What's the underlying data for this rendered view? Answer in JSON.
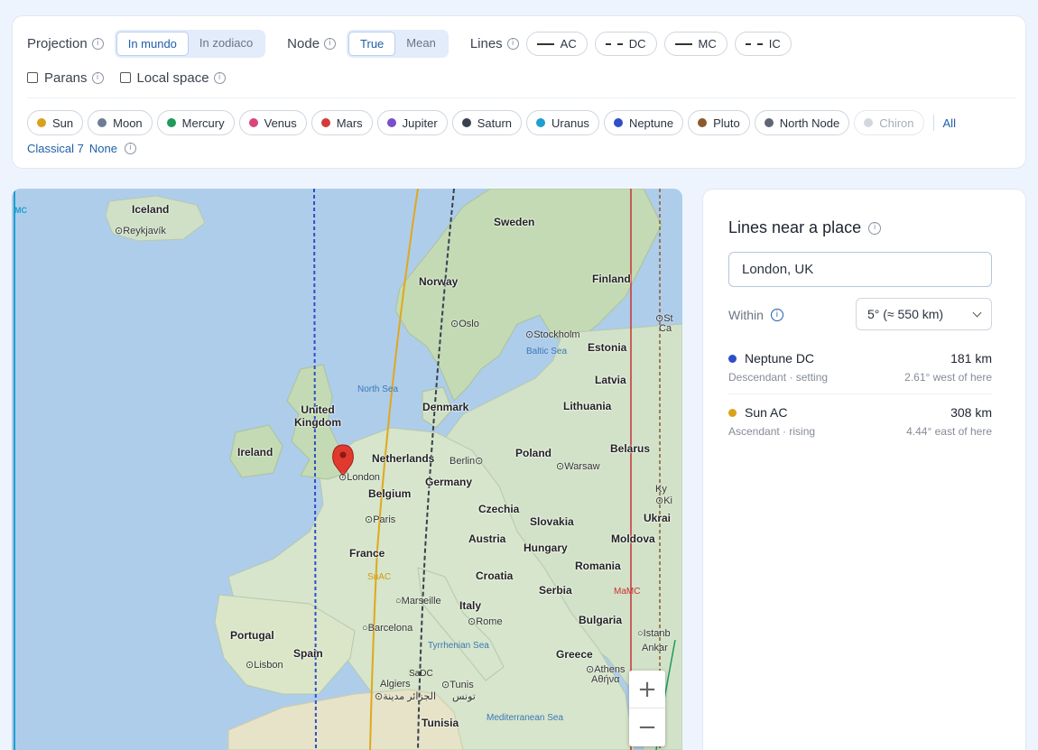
{
  "controls": {
    "projection": {
      "label": "Projection",
      "options": [
        "In mundo",
        "In zodiaco"
      ],
      "selected": "In mundo"
    },
    "node": {
      "label": "Node",
      "options": [
        "True",
        "Mean"
      ],
      "selected": "True"
    },
    "lines": {
      "label": "Lines",
      "items": [
        {
          "label": "AC",
          "style": "solid"
        },
        {
          "label": "DC",
          "style": "dashed"
        },
        {
          "label": "MC",
          "style": "solid"
        },
        {
          "label": "IC",
          "style": "dashed"
        }
      ]
    },
    "parans_label": "Parans",
    "local_space_label": "Local space",
    "planets": [
      {
        "label": "Sun",
        "color": "#d9a21b",
        "enabled": true
      },
      {
        "label": "Moon",
        "color": "#6e7c95",
        "enabled": true
      },
      {
        "label": "Mercury",
        "color": "#1f9b5a",
        "enabled": true
      },
      {
        "label": "Venus",
        "color": "#d8457a",
        "enabled": true
      },
      {
        "label": "Mars",
        "color": "#d33b3b",
        "enabled": true
      },
      {
        "label": "Jupiter",
        "color": "#7b4fc9",
        "enabled": true
      },
      {
        "label": "Saturn",
        "color": "#39414e",
        "enabled": true
      },
      {
        "label": "Uranus",
        "color": "#1f9ed1",
        "enabled": true
      },
      {
        "label": "Neptune",
        "color": "#2e4fc7",
        "enabled": true
      },
      {
        "label": "Pluto",
        "color": "#8a5a2b",
        "enabled": true
      },
      {
        "label": "North Node",
        "color": "#5f6775",
        "enabled": true
      },
      {
        "label": "Chiron",
        "color": "#d4d8de",
        "enabled": false
      }
    ],
    "all_label": "All",
    "classical_label": "Classical 7",
    "none_label": "None"
  },
  "map": {
    "countries": [
      "Iceland",
      "Sweden",
      "Norway",
      "Finland",
      "Estonia",
      "Latvia",
      "Lithuania",
      "Denmark",
      "United Kingdom",
      "Ireland",
      "Netherlands",
      "Belarus",
      "Poland",
      "Germany",
      "Belgium",
      "Czechia",
      "Slovakia",
      "Ukrai",
      "France",
      "Austria",
      "Hungary",
      "Moldova",
      "Romania",
      "Croatia",
      "Serbia",
      "Italy",
      "Bulgaria",
      "Portugal",
      "Spain",
      "Greece",
      "Tunisia"
    ],
    "cities": [
      "Reykjavík",
      "Oslo",
      "Stockholm",
      "London",
      "Berlin",
      "Warsaw",
      "Paris",
      "Marseille",
      "Rome",
      "Barcelona",
      "Lisbon",
      "Algiers",
      "الجزائر",
      "مدينة",
      "Tunis",
      "تونس",
      "Athens",
      "Αθήνα",
      "Istanb",
      "Ankar",
      "Ky",
      "Ki",
      "St",
      "Ca"
    ],
    "seas": [
      "North Sea",
      "Baltic Sea",
      "Tyrrhenian Sea",
      "Mediterranean Sea"
    ],
    "line_labels": {
      "mc_left": "MC",
      "sun_ac": "SuAC",
      "sa_dc": "SaDC",
      "ma_mc": "MaMC"
    },
    "colors": {
      "sun": "#e0a81c",
      "neptune": "#2e4fc7",
      "saturn": "#39414e",
      "mars": "#c83232",
      "uranus": "#1f9ed1",
      "pluto": "#8a5a2b",
      "mercury": "#1f9b5a"
    },
    "zoom_in": "+",
    "zoom_out": "−"
  },
  "panel": {
    "title": "Lines near a place",
    "place_value": "London, UK",
    "within_label": "Within",
    "within_value": "5° (≈ 550 km)",
    "results": [
      {
        "name": "Neptune DC",
        "color": "#2e4fc7",
        "sub": "Descendant · setting",
        "dist": "181 km",
        "dir": "2.61° west of here"
      },
      {
        "name": "Sun AC",
        "color": "#d9a21b",
        "sub": "Ascendant · rising",
        "dist": "308 km",
        "dir": "4.44° east of here"
      }
    ]
  }
}
